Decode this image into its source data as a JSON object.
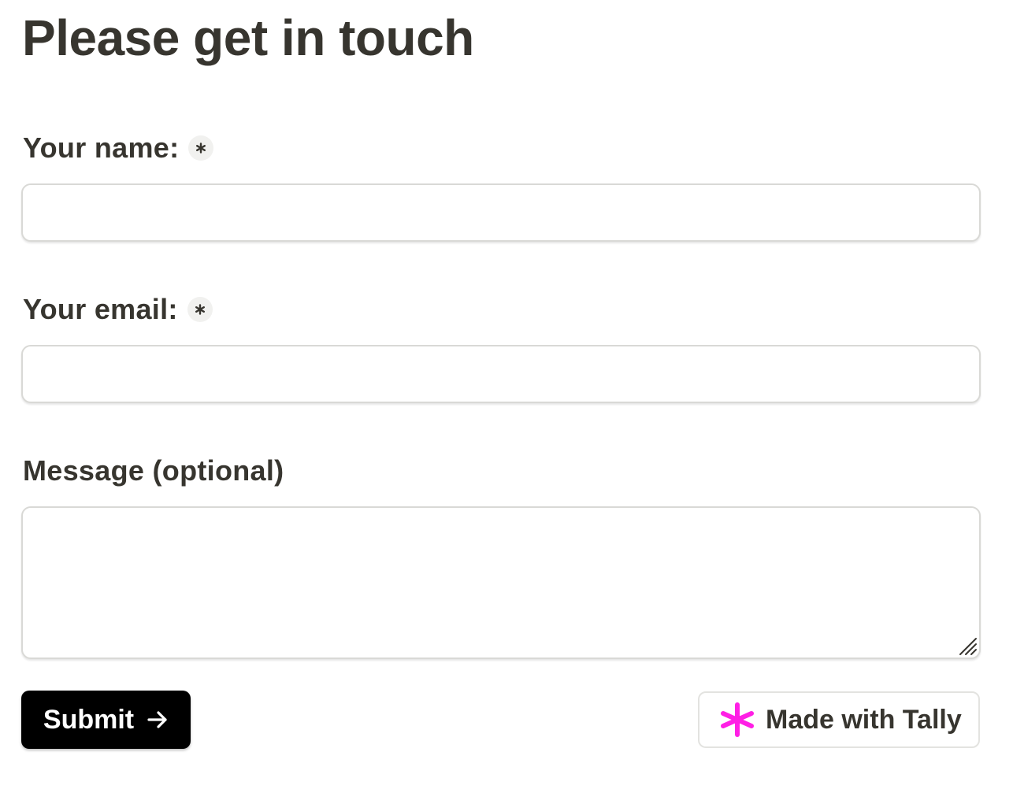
{
  "form": {
    "title": "Please get in touch",
    "fields": {
      "name": {
        "label": "Your name:",
        "required": true,
        "value": "",
        "placeholder": ""
      },
      "email": {
        "label": "Your email:",
        "required": true,
        "value": "",
        "placeholder": ""
      },
      "message": {
        "label": "Message (optional)",
        "required": false,
        "value": "",
        "placeholder": ""
      }
    },
    "submit_label": "Submit",
    "icons": {
      "required": "asterisk-icon",
      "submit": "arrow-right-icon",
      "resize": "resize-handle-icon",
      "brand": "tally-asterisk-logo"
    }
  },
  "footer": {
    "badge_text": "Made with Tally",
    "brand_color": "#ff1fe5"
  },
  "colors": {
    "text": "#37352f",
    "button_bg": "#000000",
    "button_text": "#ffffff",
    "border": "#d9d9d6"
  }
}
